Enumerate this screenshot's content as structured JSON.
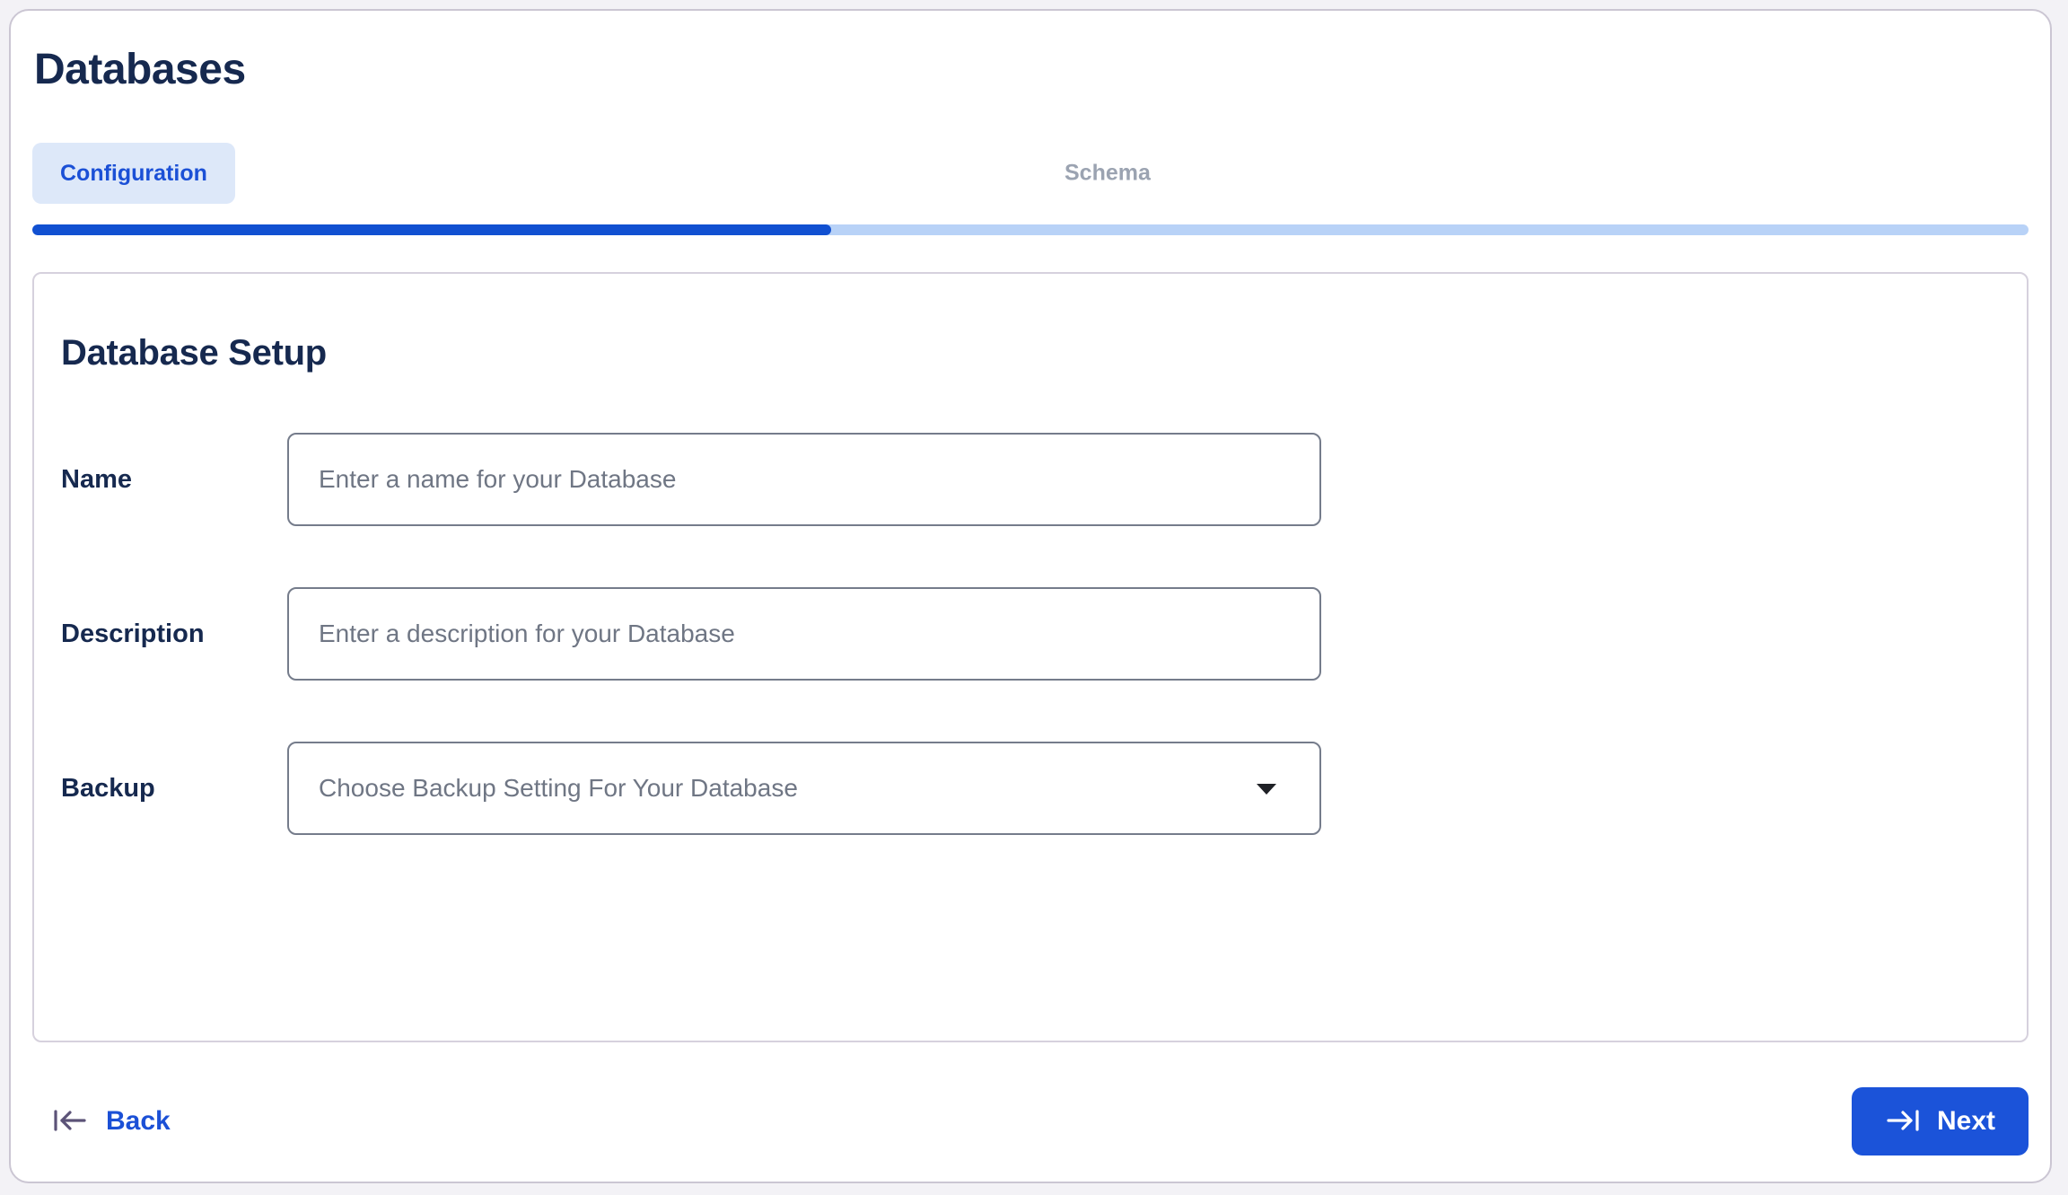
{
  "page": {
    "title": "Databases"
  },
  "tabs": {
    "items": [
      {
        "label": "Configuration",
        "active": true
      },
      {
        "label": "Schema",
        "active": false
      }
    ]
  },
  "progress": {
    "percent": 40,
    "fill_color": "#1150d1",
    "track_color": "#b8d2f7"
  },
  "setup_card": {
    "title": "Database Setup",
    "fields": [
      {
        "label": "Name",
        "type": "text",
        "value": "",
        "placeholder": "Enter a name for your Database"
      },
      {
        "label": "Description",
        "type": "text",
        "value": "",
        "placeholder": "Enter a description for your Database"
      },
      {
        "label": "Backup",
        "type": "select",
        "value": "",
        "placeholder": "Choose Backup Setting For Your Database",
        "icon": "caret-down-icon"
      }
    ]
  },
  "footer": {
    "back": {
      "label": "Back",
      "icon": "arrow-left-to-bar-icon"
    },
    "next": {
      "label": "Next",
      "icon": "arrow-right-to-bar-icon"
    }
  },
  "colors": {
    "accent_blue": "#1b50d6",
    "navy_text": "#16294f",
    "chip_bg": "#dde8f9",
    "inactive_tab_text": "#9ba3b1",
    "placeholder_text": "#6f7684",
    "input_border": "#757c8b",
    "card_border": "#d6d1dd",
    "window_border": "#cbc6d3",
    "back_icon": "#5c5378"
  }
}
